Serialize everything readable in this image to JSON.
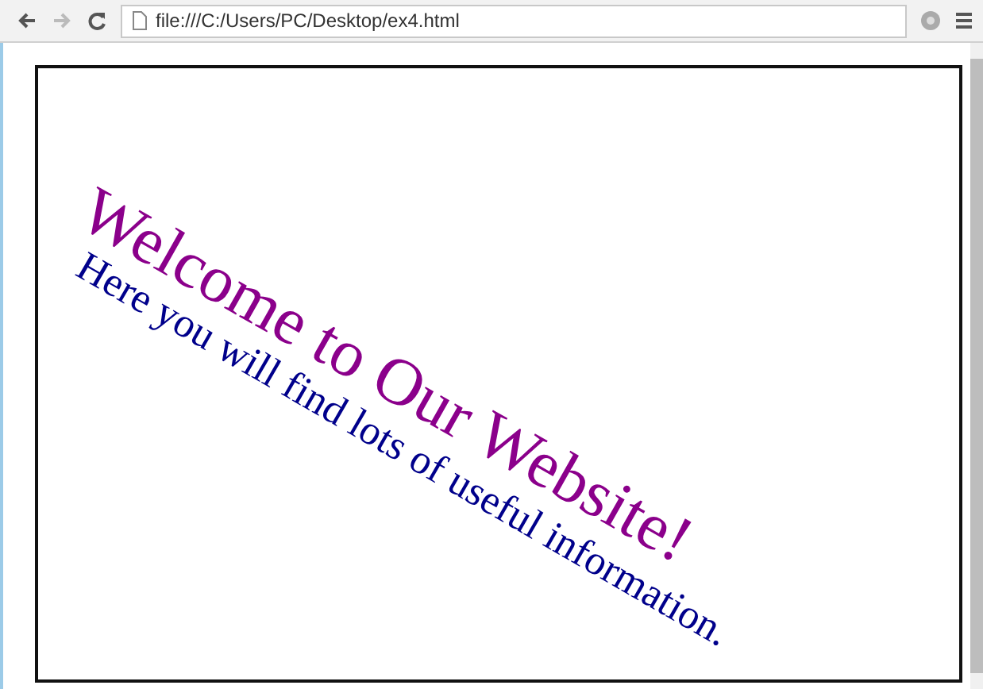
{
  "address_bar": {
    "url": "file:///C:/Users/PC/Desktop/ex4.html"
  },
  "page": {
    "heading": "Welcome to Our Website!",
    "subheading": "Here you will find lots of useful information."
  }
}
